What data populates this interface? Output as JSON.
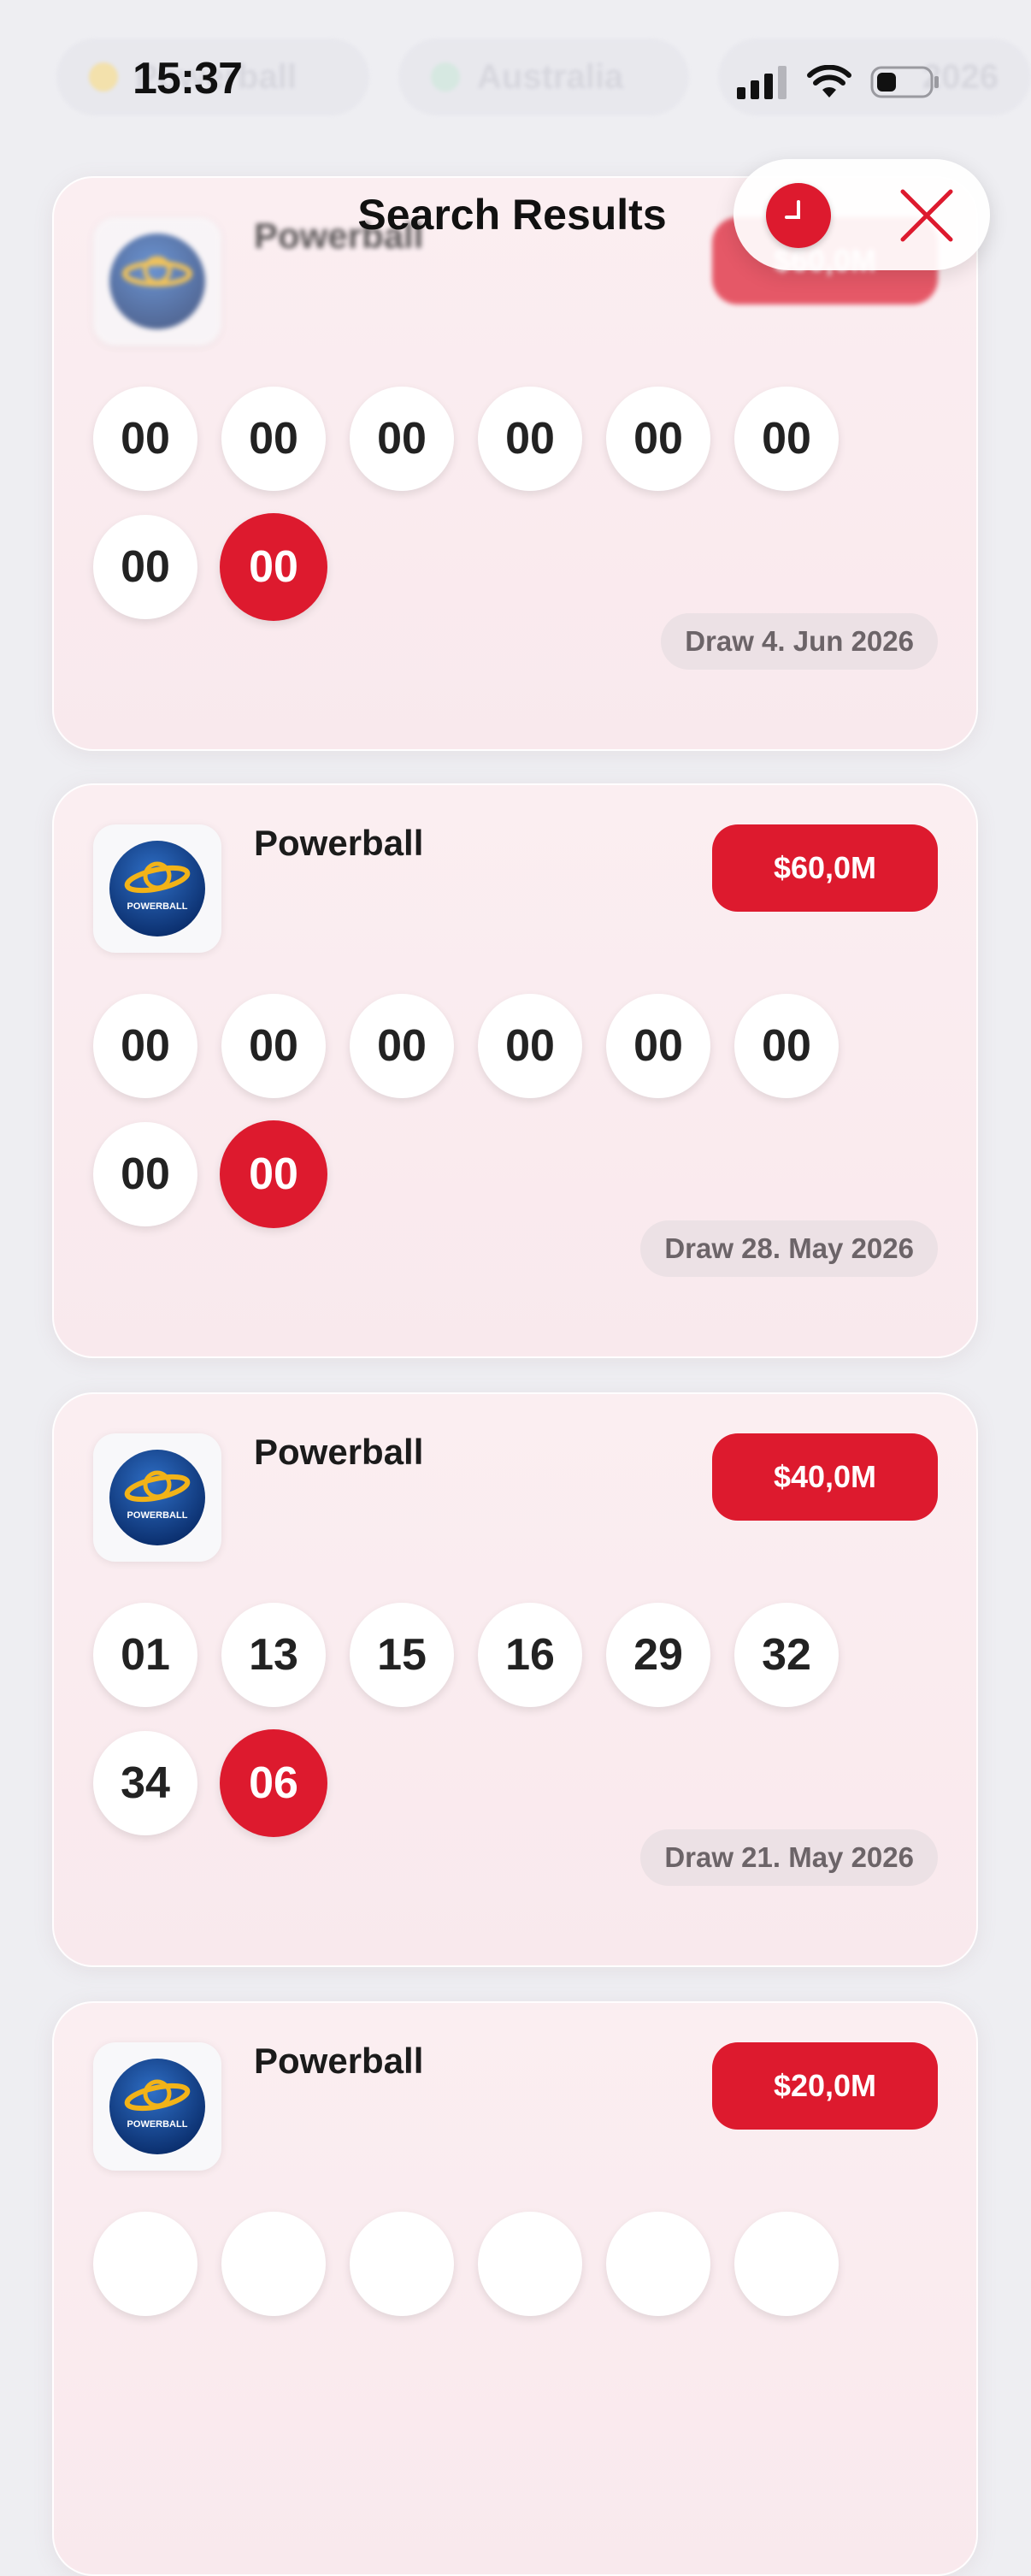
{
  "status_bar": {
    "time": "15:37"
  },
  "background_tabs": [
    {
      "label": "Powerball",
      "dot_color": "#f2c94c"
    },
    {
      "label": "Australia",
      "dot_color": "#a7d9c5"
    },
    {
      "label": "2026",
      "dot_color": "#9aa9e0"
    }
  ],
  "header": {
    "title": "Search Results"
  },
  "colors": {
    "accent": "#dd1a2e",
    "card_bg": "#fbeef1"
  },
  "results": [
    {
      "name": "Powerball",
      "jackpot": "$60,0M",
      "numbers": [
        "00",
        "00",
        "00",
        "00",
        "00",
        "00",
        "00"
      ],
      "powerball": "00",
      "draw_date": "Draw 4. Jun 2026"
    },
    {
      "name": "Powerball",
      "jackpot": "$60,0M",
      "numbers": [
        "00",
        "00",
        "00",
        "00",
        "00",
        "00",
        "00"
      ],
      "powerball": "00",
      "draw_date": "Draw 28. May 2026"
    },
    {
      "name": "Powerball",
      "jackpot": "$40,0M",
      "numbers": [
        "01",
        "13",
        "15",
        "16",
        "29",
        "32",
        "34"
      ],
      "powerball": "06",
      "draw_date": "Draw 21. May 2026"
    },
    {
      "name": "Powerball",
      "jackpot": "$20,0M",
      "numbers": [
        "",
        "",
        "",
        "",
        "",
        "",
        ""
      ],
      "powerball": "",
      "draw_date": ""
    }
  ],
  "logo_text": "POWERBALL",
  "icons": {
    "history": "clock-icon",
    "close": "close-icon"
  }
}
